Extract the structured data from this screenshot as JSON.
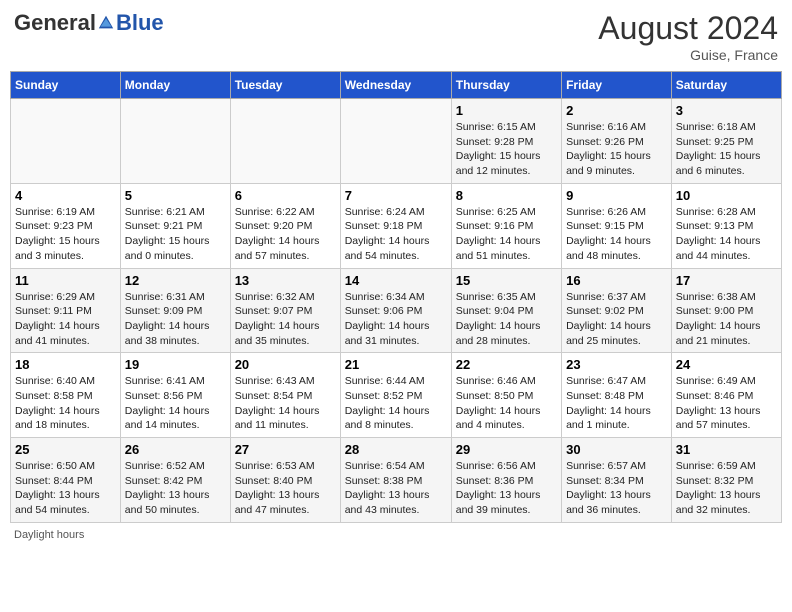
{
  "header": {
    "logo_general": "General",
    "logo_blue": "Blue",
    "month_year": "August 2024",
    "location": "Guise, France"
  },
  "days_of_week": [
    "Sunday",
    "Monday",
    "Tuesday",
    "Wednesday",
    "Thursday",
    "Friday",
    "Saturday"
  ],
  "weeks": [
    [
      {
        "day": "",
        "sunrise": "",
        "sunset": "",
        "daylight": ""
      },
      {
        "day": "",
        "sunrise": "",
        "sunset": "",
        "daylight": ""
      },
      {
        "day": "",
        "sunrise": "",
        "sunset": "",
        "daylight": ""
      },
      {
        "day": "",
        "sunrise": "",
        "sunset": "",
        "daylight": ""
      },
      {
        "day": "1",
        "sunrise": "Sunrise: 6:15 AM",
        "sunset": "Sunset: 9:28 PM",
        "daylight": "Daylight: 15 hours and 12 minutes."
      },
      {
        "day": "2",
        "sunrise": "Sunrise: 6:16 AM",
        "sunset": "Sunset: 9:26 PM",
        "daylight": "Daylight: 15 hours and 9 minutes."
      },
      {
        "day": "3",
        "sunrise": "Sunrise: 6:18 AM",
        "sunset": "Sunset: 9:25 PM",
        "daylight": "Daylight: 15 hours and 6 minutes."
      }
    ],
    [
      {
        "day": "4",
        "sunrise": "Sunrise: 6:19 AM",
        "sunset": "Sunset: 9:23 PM",
        "daylight": "Daylight: 15 hours and 3 minutes."
      },
      {
        "day": "5",
        "sunrise": "Sunrise: 6:21 AM",
        "sunset": "Sunset: 9:21 PM",
        "daylight": "Daylight: 15 hours and 0 minutes."
      },
      {
        "day": "6",
        "sunrise": "Sunrise: 6:22 AM",
        "sunset": "Sunset: 9:20 PM",
        "daylight": "Daylight: 14 hours and 57 minutes."
      },
      {
        "day": "7",
        "sunrise": "Sunrise: 6:24 AM",
        "sunset": "Sunset: 9:18 PM",
        "daylight": "Daylight: 14 hours and 54 minutes."
      },
      {
        "day": "8",
        "sunrise": "Sunrise: 6:25 AM",
        "sunset": "Sunset: 9:16 PM",
        "daylight": "Daylight: 14 hours and 51 minutes."
      },
      {
        "day": "9",
        "sunrise": "Sunrise: 6:26 AM",
        "sunset": "Sunset: 9:15 PM",
        "daylight": "Daylight: 14 hours and 48 minutes."
      },
      {
        "day": "10",
        "sunrise": "Sunrise: 6:28 AM",
        "sunset": "Sunset: 9:13 PM",
        "daylight": "Daylight: 14 hours and 44 minutes."
      }
    ],
    [
      {
        "day": "11",
        "sunrise": "Sunrise: 6:29 AM",
        "sunset": "Sunset: 9:11 PM",
        "daylight": "Daylight: 14 hours and 41 minutes."
      },
      {
        "day": "12",
        "sunrise": "Sunrise: 6:31 AM",
        "sunset": "Sunset: 9:09 PM",
        "daylight": "Daylight: 14 hours and 38 minutes."
      },
      {
        "day": "13",
        "sunrise": "Sunrise: 6:32 AM",
        "sunset": "Sunset: 9:07 PM",
        "daylight": "Daylight: 14 hours and 35 minutes."
      },
      {
        "day": "14",
        "sunrise": "Sunrise: 6:34 AM",
        "sunset": "Sunset: 9:06 PM",
        "daylight": "Daylight: 14 hours and 31 minutes."
      },
      {
        "day": "15",
        "sunrise": "Sunrise: 6:35 AM",
        "sunset": "Sunset: 9:04 PM",
        "daylight": "Daylight: 14 hours and 28 minutes."
      },
      {
        "day": "16",
        "sunrise": "Sunrise: 6:37 AM",
        "sunset": "Sunset: 9:02 PM",
        "daylight": "Daylight: 14 hours and 25 minutes."
      },
      {
        "day": "17",
        "sunrise": "Sunrise: 6:38 AM",
        "sunset": "Sunset: 9:00 PM",
        "daylight": "Daylight: 14 hours and 21 minutes."
      }
    ],
    [
      {
        "day": "18",
        "sunrise": "Sunrise: 6:40 AM",
        "sunset": "Sunset: 8:58 PM",
        "daylight": "Daylight: 14 hours and 18 minutes."
      },
      {
        "day": "19",
        "sunrise": "Sunrise: 6:41 AM",
        "sunset": "Sunset: 8:56 PM",
        "daylight": "Daylight: 14 hours and 14 minutes."
      },
      {
        "day": "20",
        "sunrise": "Sunrise: 6:43 AM",
        "sunset": "Sunset: 8:54 PM",
        "daylight": "Daylight: 14 hours and 11 minutes."
      },
      {
        "day": "21",
        "sunrise": "Sunrise: 6:44 AM",
        "sunset": "Sunset: 8:52 PM",
        "daylight": "Daylight: 14 hours and 8 minutes."
      },
      {
        "day": "22",
        "sunrise": "Sunrise: 6:46 AM",
        "sunset": "Sunset: 8:50 PM",
        "daylight": "Daylight: 14 hours and 4 minutes."
      },
      {
        "day": "23",
        "sunrise": "Sunrise: 6:47 AM",
        "sunset": "Sunset: 8:48 PM",
        "daylight": "Daylight: 14 hours and 1 minute."
      },
      {
        "day": "24",
        "sunrise": "Sunrise: 6:49 AM",
        "sunset": "Sunset: 8:46 PM",
        "daylight": "Daylight: 13 hours and 57 minutes."
      }
    ],
    [
      {
        "day": "25",
        "sunrise": "Sunrise: 6:50 AM",
        "sunset": "Sunset: 8:44 PM",
        "daylight": "Daylight: 13 hours and 54 minutes."
      },
      {
        "day": "26",
        "sunrise": "Sunrise: 6:52 AM",
        "sunset": "Sunset: 8:42 PM",
        "daylight": "Daylight: 13 hours and 50 minutes."
      },
      {
        "day": "27",
        "sunrise": "Sunrise: 6:53 AM",
        "sunset": "Sunset: 8:40 PM",
        "daylight": "Daylight: 13 hours and 47 minutes."
      },
      {
        "day": "28",
        "sunrise": "Sunrise: 6:54 AM",
        "sunset": "Sunset: 8:38 PM",
        "daylight": "Daylight: 13 hours and 43 minutes."
      },
      {
        "day": "29",
        "sunrise": "Sunrise: 6:56 AM",
        "sunset": "Sunset: 8:36 PM",
        "daylight": "Daylight: 13 hours and 39 minutes."
      },
      {
        "day": "30",
        "sunrise": "Sunrise: 6:57 AM",
        "sunset": "Sunset: 8:34 PM",
        "daylight": "Daylight: 13 hours and 36 minutes."
      },
      {
        "day": "31",
        "sunrise": "Sunrise: 6:59 AM",
        "sunset": "Sunset: 8:32 PM",
        "daylight": "Daylight: 13 hours and 32 minutes."
      }
    ]
  ],
  "footer": {
    "daylight_label": "Daylight hours"
  }
}
